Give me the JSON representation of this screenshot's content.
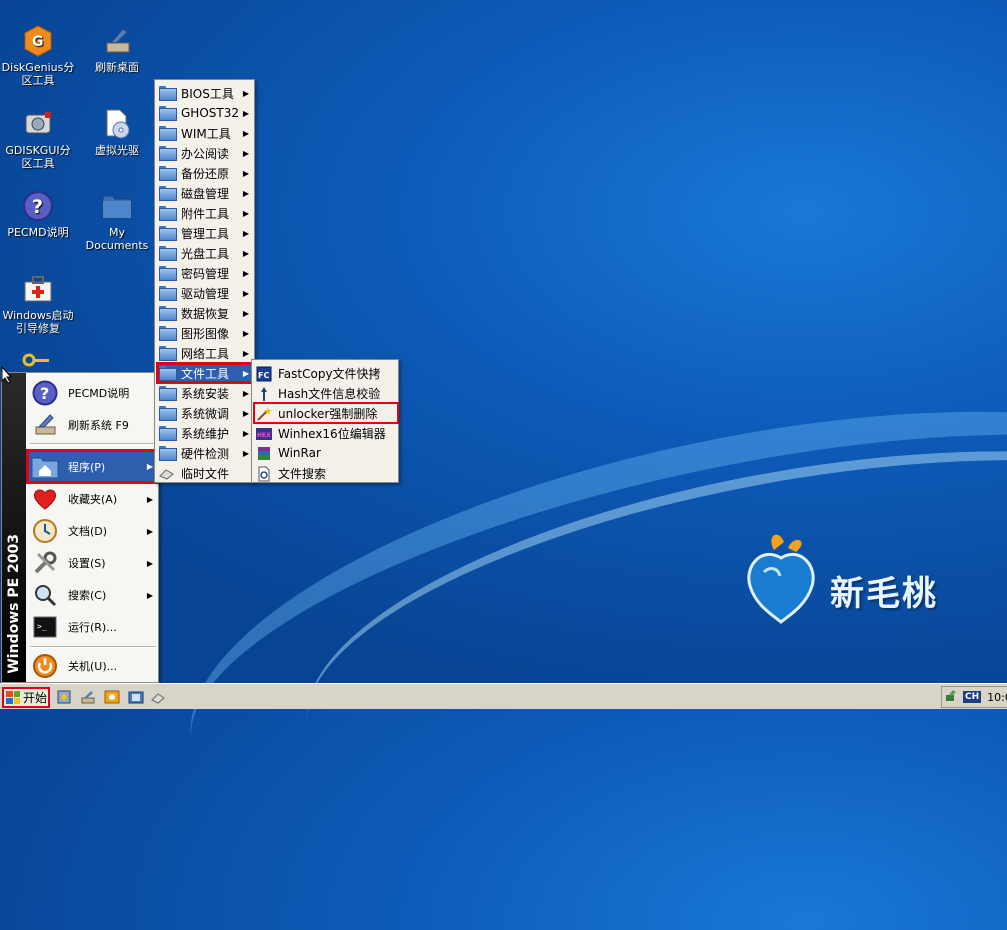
{
  "desktop": {
    "icons": [
      {
        "label": "DiskGenius分区工具",
        "icon": "diskgenius-icon"
      },
      {
        "label": "刷新桌面",
        "icon": "refresh-desktop-icon"
      },
      {
        "label": "GDISKGUI分区工具",
        "icon": "gdiskgui-icon"
      },
      {
        "label": "虚拟光驱",
        "icon": "virtual-drive-icon"
      },
      {
        "label": "PECMD说明",
        "icon": "help-icon"
      },
      {
        "label": "My Documents",
        "icon": "folder-icon"
      },
      {
        "label": "Windows启动引导修复",
        "icon": "boot-repair-icon"
      }
    ],
    "logo_text": "新毛桃"
  },
  "start_menu": {
    "banner": "Windows PE 2003",
    "items": [
      {
        "label": "PECMD说明",
        "icon": "help-icon",
        "has_arrow": false
      },
      {
        "label": "刷新系统 F9",
        "icon": "refresh-icon",
        "has_arrow": false
      },
      {
        "label": "程序(P)",
        "icon": "programs-icon",
        "has_arrow": true
      },
      {
        "label": "收藏夹(A)",
        "icon": "favorites-heart-icon",
        "has_arrow": true
      },
      {
        "label": "文档(D)",
        "icon": "documents-icon",
        "has_arrow": true
      },
      {
        "label": "设置(S)",
        "icon": "settings-tools-icon",
        "has_arrow": true
      },
      {
        "label": "搜索(C)",
        "icon": "search-icon",
        "has_arrow": true
      },
      {
        "label": "运行(R)...",
        "icon": "run-icon",
        "has_arrow": false
      },
      {
        "label": "关机(U)...",
        "icon": "shutdown-icon",
        "has_arrow": false
      }
    ]
  },
  "programs_menu": {
    "items": [
      {
        "label": "BIOS工具"
      },
      {
        "label": "GHOST32"
      },
      {
        "label": "WIM工具"
      },
      {
        "label": "办公阅读"
      },
      {
        "label": "备份还原"
      },
      {
        "label": "磁盘管理"
      },
      {
        "label": "附件工具"
      },
      {
        "label": "管理工具"
      },
      {
        "label": "光盘工具"
      },
      {
        "label": "密码管理"
      },
      {
        "label": "驱动管理"
      },
      {
        "label": "数据恢复"
      },
      {
        "label": "图形图像"
      },
      {
        "label": "网络工具"
      },
      {
        "label": "文件工具"
      },
      {
        "label": "系统安装"
      },
      {
        "label": "系统微调"
      },
      {
        "label": "系统维护"
      },
      {
        "label": "硬件检测"
      },
      {
        "label": "临时文件"
      }
    ]
  },
  "file_tools_menu": {
    "items": [
      {
        "label": "FastCopy文件快拷",
        "icon": "fastcopy-icon"
      },
      {
        "label": "Hash文件信息校验",
        "icon": "hash-icon"
      },
      {
        "label": "unlocker强制删除",
        "icon": "unlocker-wand-icon"
      },
      {
        "label": "Winhex16位编辑器",
        "icon": "winhex-icon"
      },
      {
        "label": "WinRar",
        "icon": "winrar-icon"
      },
      {
        "label": "文件搜索",
        "icon": "file-search-icon"
      }
    ]
  },
  "taskbar": {
    "start_label": "开始",
    "language": "CH",
    "clock": "10:0"
  },
  "colors": {
    "highlight": "#2d5fae",
    "annotation_red": "#e0001a",
    "desktop_blue": "#0d5bb8"
  }
}
